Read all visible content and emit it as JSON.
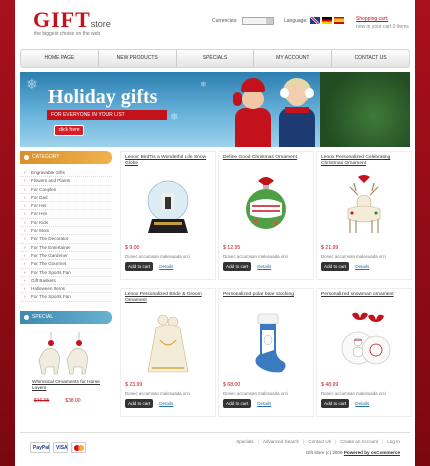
{
  "header": {
    "logo_main": "GIFT",
    "logo_sub": "store",
    "tagline": "the biggest choise on the web",
    "currencies_label": "Currencies:",
    "language_label": "Language:",
    "cart_title": "Shopping cart:",
    "cart_info": "now in your cart 0 items"
  },
  "nav": [
    "HOME PAGE",
    "NEW PRODUCTS",
    "SPECIALS",
    "MY ACCOUNT",
    "CONTACT US"
  ],
  "banner": {
    "title": "Holiday gifts",
    "subtitle": "FOR EVERYONE IN YOUR LIST",
    "button": "click here"
  },
  "sidebar": {
    "category_title": "CATEGORY",
    "categories": [
      "Engravable Gifts",
      "Flowers and Plants",
      "For Couples",
      "For Dad",
      "For Her",
      "For Him",
      "For Kids",
      "For Mom",
      "For The Decorator",
      "For The Entertainer",
      "For The Gardener",
      "For The Gourmet",
      "For The Sports Fan",
      "Gift Baskets",
      "Halloween Items",
      "For The Sports Fan"
    ],
    "special_title": "SPECIAL",
    "special": {
      "name": "Whimsical Ornaments for Horse Lovers",
      "old_price": "$46.65",
      "new_price": "$38.00"
    }
  },
  "products": [
    {
      "name": "Lenox' BirdTis a Wonderful Life Snow Globe",
      "price": "$ 9.00",
      "desc": "Donec accumsan malesuada orci",
      "icon": "snow-globe-icon"
    },
    {
      "name": "Define Good Christmas Ornament",
      "price": "$ 12.95",
      "desc": "Donec accumsan malesuada orci",
      "icon": "green-ornament-icon"
    },
    {
      "name": "Lenox Personalized Celebrating Christmas Ornament",
      "price": "$ 21.99",
      "desc": "Donec accumsan malesuada orci",
      "icon": "deer-ornament-icon"
    },
    {
      "name": "Lenox Personalized Bride & Groom Ornament",
      "price": "$ 23.99",
      "desc": "Donec accumsan malesuada orci",
      "icon": "couple-ornament-icon"
    },
    {
      "name": "Personalized polar bear stocking",
      "price": "$ 68.00",
      "desc": "Donec accumsan malesuada orci",
      "icon": "stocking-icon"
    },
    {
      "name": "Personalized snowman ornament",
      "price": "$ 48.99",
      "desc": "Donec accumsan malesuada orci",
      "icon": "snowman-ornament-icon"
    }
  ],
  "buttons": {
    "add_to_cart": "Add to cart",
    "details": "Details"
  },
  "footer": {
    "links": [
      "Specials",
      "Advanced Search",
      "Contact Us",
      "Create an Account",
      "Log In"
    ],
    "copyright_prefix": "Gift store (c) 2009",
    "copyright_powered": "Powered by osCommerce",
    "payments": [
      "PayPal",
      "VISA",
      "MasterCard"
    ]
  },
  "colors": {
    "brand_red": "#c4121d",
    "category_orange": "#e8a23c",
    "special_blue": "#4f9bbf",
    "banner_blue": "#4a9dcb"
  }
}
